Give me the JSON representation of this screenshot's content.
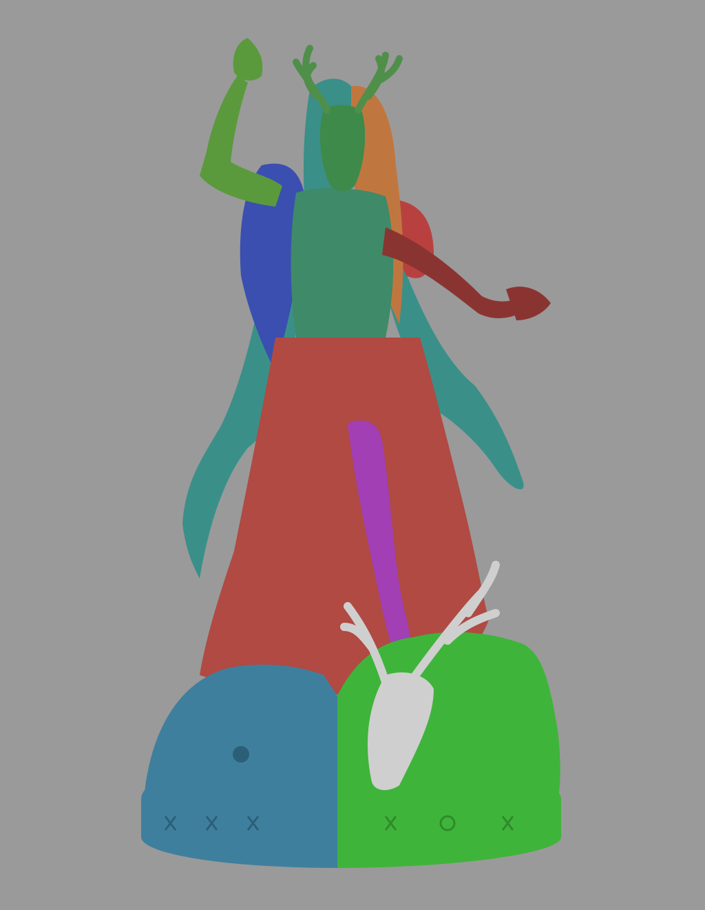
{
  "colors": {
    "background": "#9a9a9a",
    "skin": "#3f8a68",
    "left_arm": "#5a9a3c",
    "mask": "#3e8a4a",
    "antlers": "#4f8f4a",
    "hair_teal": "#3a8f88",
    "hair_orange": "#c0773f",
    "cloak_teal": "#3a9088",
    "feathers_blue": "#3a4fb0",
    "feathers_red": "#b8413f",
    "right_arm": "#8a3432",
    "skirt_red": "#b04a42",
    "leg_purple": "#a23fb4",
    "base_blue": "#3f7f9e",
    "base_green": "#3fb43a",
    "skull_white": "#cfcfcf"
  },
  "icons": [
    "deer-antler-icon",
    "deer-skull-icon",
    "bird-skull-icon",
    "rune-icon"
  ]
}
